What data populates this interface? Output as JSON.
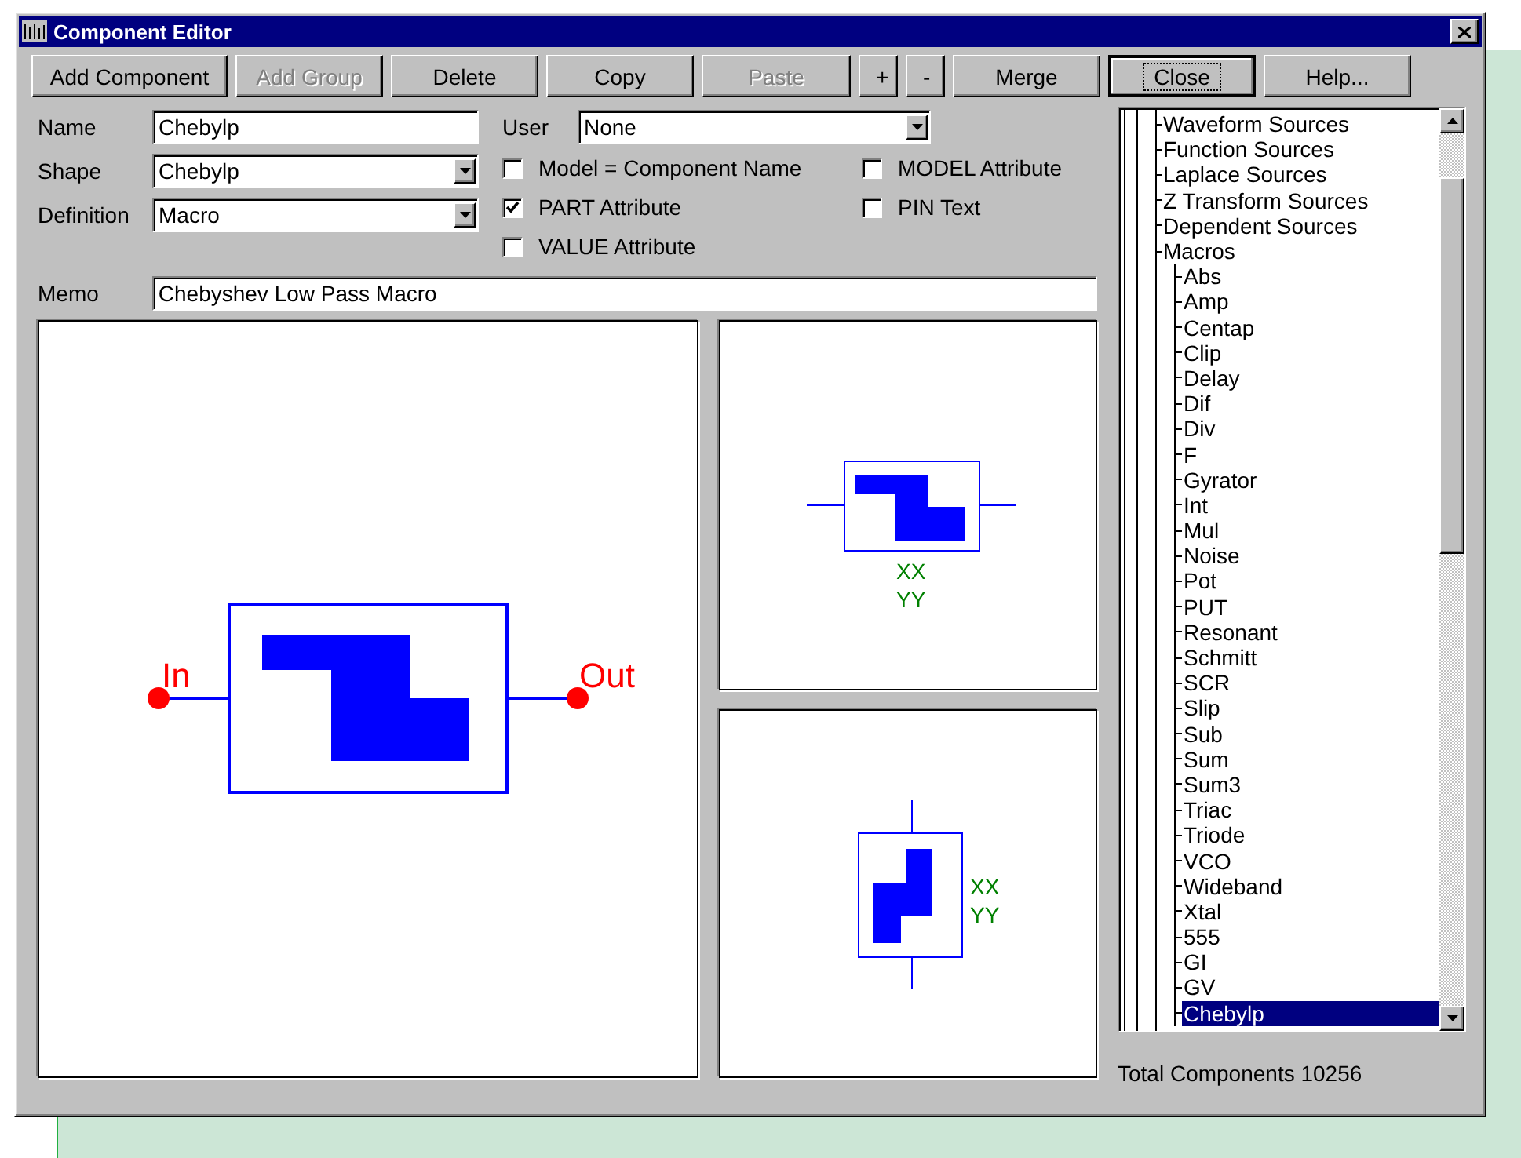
{
  "window": {
    "title": "Component Editor"
  },
  "toolbar": [
    {
      "label": "Add Component",
      "disabled": false,
      "focused": false
    },
    {
      "label": "Add Group",
      "disabled": true,
      "focused": false
    },
    {
      "label": "Delete",
      "disabled": false,
      "focused": false
    },
    {
      "label": "Copy",
      "disabled": false,
      "focused": false
    },
    {
      "label": "Paste",
      "disabled": true,
      "focused": false
    },
    {
      "label": "+",
      "disabled": false,
      "focused": false
    },
    {
      "label": "-",
      "disabled": false,
      "focused": false
    },
    {
      "label": "Merge",
      "disabled": false,
      "focused": false
    },
    {
      "label": "Close",
      "disabled": false,
      "focused": true
    },
    {
      "label": "Help...",
      "disabled": false,
      "focused": false
    }
  ],
  "fields": [
    {
      "label": "Name",
      "kind": "text",
      "value": "Chebylp"
    },
    {
      "label": "Shape",
      "kind": "dropdown",
      "value": "Chebylp"
    },
    {
      "label": "Definition",
      "kind": "dropdown",
      "value": "Macro"
    }
  ],
  "user": {
    "label": "User",
    "value": "None"
  },
  "checkboxes": [
    {
      "label": "Model = Component Name",
      "checked": false
    },
    {
      "label": "MODEL Attribute",
      "checked": false
    },
    {
      "label": "PART Attribute",
      "checked": true
    },
    {
      "label": "PIN Text",
      "checked": false
    },
    {
      "label": "VALUE Attribute",
      "checked": false
    }
  ],
  "memo": {
    "label": "Memo",
    "value": "Chebyshev Low Pass Macro"
  },
  "symbol_views": [
    {
      "kind": "large",
      "labels": [
        "In",
        "Out"
      ]
    },
    {
      "kind": "horizontal",
      "labels": [
        "XX",
        "YY"
      ]
    },
    {
      "kind": "vertical",
      "labels": [
        "XX",
        "YY"
      ]
    }
  ],
  "tree": [
    {
      "label": "Waveform Sources",
      "selected": false
    },
    {
      "label": "Function Sources",
      "selected": false
    },
    {
      "label": "Laplace Sources",
      "selected": false
    },
    {
      "label": "Z Transform Sources",
      "selected": false
    },
    {
      "label": "Dependent Sources",
      "selected": false
    },
    {
      "label": "Macros",
      "selected": false,
      "children": [
        {
          "label": "Abs",
          "selected": false
        },
        {
          "label": "Amp",
          "selected": false
        },
        {
          "label": "Centap",
          "selected": false
        },
        {
          "label": "Clip",
          "selected": false
        },
        {
          "label": "Delay",
          "selected": false
        },
        {
          "label": "Dif",
          "selected": false
        },
        {
          "label": "Div",
          "selected": false
        },
        {
          "label": "F",
          "selected": false
        },
        {
          "label": "Gyrator",
          "selected": false
        },
        {
          "label": "Int",
          "selected": false
        },
        {
          "label": "Mul",
          "selected": false
        },
        {
          "label": "Noise",
          "selected": false
        },
        {
          "label": "Pot",
          "selected": false
        },
        {
          "label": "PUT",
          "selected": false
        },
        {
          "label": "Resonant",
          "selected": false
        },
        {
          "label": "Schmitt",
          "selected": false
        },
        {
          "label": "SCR",
          "selected": false
        },
        {
          "label": "Slip",
          "selected": false
        },
        {
          "label": "Sub",
          "selected": false
        },
        {
          "label": "Sum",
          "selected": false
        },
        {
          "label": "Sum3",
          "selected": false
        },
        {
          "label": "Triac",
          "selected": false
        },
        {
          "label": "Triode",
          "selected": false
        },
        {
          "label": "VCO",
          "selected": false
        },
        {
          "label": "Wideband",
          "selected": false
        },
        {
          "label": "Xtal",
          "selected": false
        },
        {
          "label": "555",
          "selected": false
        },
        {
          "label": "GI",
          "selected": false
        },
        {
          "label": "GV",
          "selected": false
        },
        {
          "label": "Chebylp",
          "selected": true
        }
      ]
    }
  ],
  "status": "Total Components 10256"
}
